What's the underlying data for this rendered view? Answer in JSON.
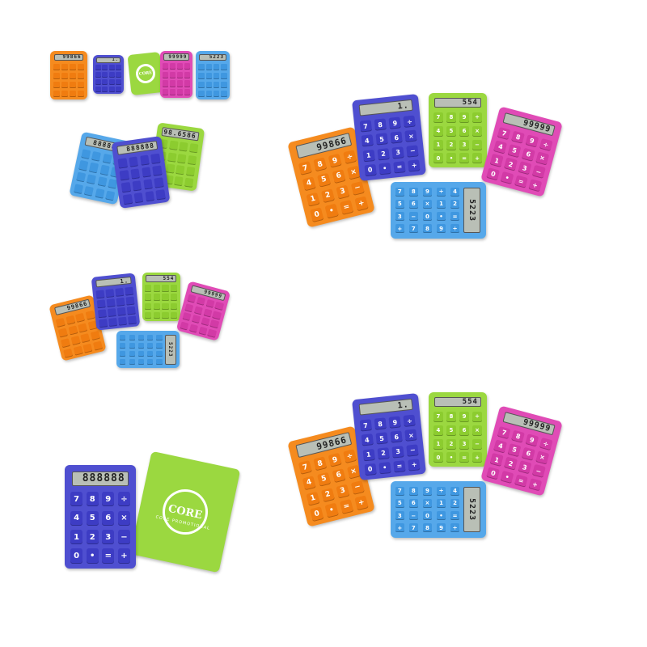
{
  "colors": {
    "orange": "#f58b1f",
    "orange_key": "#f07c10",
    "blue_violet": "#4f4fd0",
    "blue_violet_key": "#3d3cc4",
    "lime": "#9bd840",
    "lime_key": "#8ccc2f",
    "magenta": "#e04bb6",
    "magenta_key": "#d23aa6",
    "sky": "#56a8ea",
    "sky_key": "#3f97e0"
  },
  "displays": {
    "orange": "99866",
    "blue_violet": "1.",
    "lime": "554",
    "magenta": "99999",
    "sky": "5223",
    "blank": "888888",
    "top_row_sky": "5223",
    "top_row_magenta": "99999",
    "lime_long": "9998.6586"
  },
  "keypad": [
    "7",
    "8",
    "9",
    "÷",
    "4",
    "5",
    "6",
    "×",
    "1",
    "2",
    "3",
    "−",
    "0",
    "•",
    "=",
    "+"
  ],
  "cover": {
    "logo_text": "CORE",
    "tagline": "CORE PROMOTIONAL"
  },
  "panels": [
    {
      "name": "five-calculators-row",
      "view": "row"
    },
    {
      "name": "three-calculators-angled",
      "view": "angled"
    },
    {
      "name": "five-calculators-arrangement-large",
      "view": "arrangement"
    },
    {
      "name": "five-calculators-arrangement-small",
      "view": "arrangement"
    },
    {
      "name": "calculator-with-cover",
      "view": "cover"
    },
    {
      "name": "five-calculators-arrangement-bottom",
      "view": "arrangement"
    }
  ]
}
